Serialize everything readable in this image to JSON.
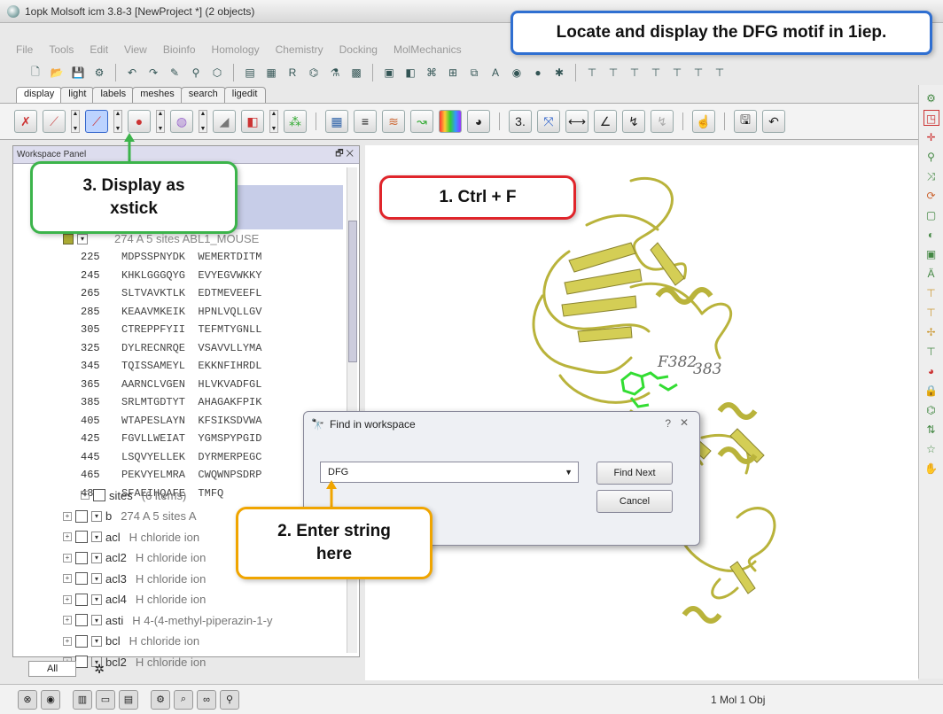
{
  "window": {
    "title": "1opk Molsoft icm 3.8-3  [NewProject *] (2 objects)"
  },
  "menu": [
    "File",
    "Tools",
    "Edit",
    "View",
    "Bioinfo",
    "Homology",
    "Chemistry",
    "Docking",
    "MolMechanics"
  ],
  "tabs": [
    "display",
    "light",
    "labels",
    "meshes",
    "search",
    "ligedit"
  ],
  "workspace": {
    "title": "Workspace Panel",
    "selected_object": "274 A  5 sites ABL1_MOUSE",
    "sequence": [
      {
        "num": "225",
        "text": "MDPSSPNYDK  WEMERTDITM"
      },
      {
        "num": "245",
        "text": "KHKLGGGQYG  EVYEGVWKKY"
      },
      {
        "num": "265",
        "text": "SLTVAVKTLK  EDTMEVEEFL"
      },
      {
        "num": "285",
        "text": "KEAAVMKEIK  HPNLVQLLGV"
      },
      {
        "num": "305",
        "text": "CTREPPFYII  TEFMTYGNLL"
      },
      {
        "num": "325",
        "text": "DYLRECNRQE  VSAVVLLYMA"
      },
      {
        "num": "345",
        "text": "TQISSAMEYL  EKKNFIHRDL"
      },
      {
        "num": "365",
        "text": "AARNCLVGEN  HLVKVADFGL"
      },
      {
        "num": "385",
        "text": "SRLMTGDTYT  AHAGAKFPIK"
      },
      {
        "num": "405",
        "text": "WTAPESLAYN  KFSIKSDVWA"
      },
      {
        "num": "425",
        "text": "FGVLLWEIAT  YGMSPYPGID"
      },
      {
        "num": "445",
        "text": "LSQVYELLEK  DYRMERPEGC"
      },
      {
        "num": "465",
        "text": "PEKVYELMRA  CWQWNPSDRP"
      },
      {
        "num": "485",
        "text": "SFAEIHQAFE  TMFQ"
      }
    ],
    "tree": [
      {
        "name": "sites",
        "desc": "(6 items)"
      },
      {
        "name": "b",
        "desc": "274 A  5 sites A"
      },
      {
        "name": "acl",
        "desc": "H  chloride ion"
      },
      {
        "name": "acl2",
        "desc": "H  chloride ion"
      },
      {
        "name": "acl3",
        "desc": "H  chloride ion"
      },
      {
        "name": "acl4",
        "desc": "H  chloride ion"
      },
      {
        "name": "asti",
        "desc": "H  4-(4-methyl-piperazin-1-y"
      },
      {
        "name": "bcl",
        "desc": "H  chloride ion"
      },
      {
        "name": "bcl2",
        "desc": "H  chloride ion"
      }
    ],
    "bottom_tab": "All"
  },
  "viewer": {
    "label": "F382",
    "label2": "383"
  },
  "dialog": {
    "title": "Find in workspace",
    "query": "DFG",
    "find_next": "Find Next",
    "cancel": "Cancel"
  },
  "status": {
    "text": "1 Mol 1 Obj"
  },
  "callouts": {
    "task": "Locate and display the DFG motif in 1iep.",
    "step1": "1. Ctrl + F",
    "step2a": "2. Enter string",
    "step2b": "here",
    "step3a": "3. Display as",
    "step3b": "xstick"
  },
  "colors": {
    "blue_callout": "#2f6fd1",
    "red_callout": "#e0252b",
    "green_callout": "#3cb44b",
    "orange_callout": "#f0a500",
    "protein": "#c8c24a"
  }
}
